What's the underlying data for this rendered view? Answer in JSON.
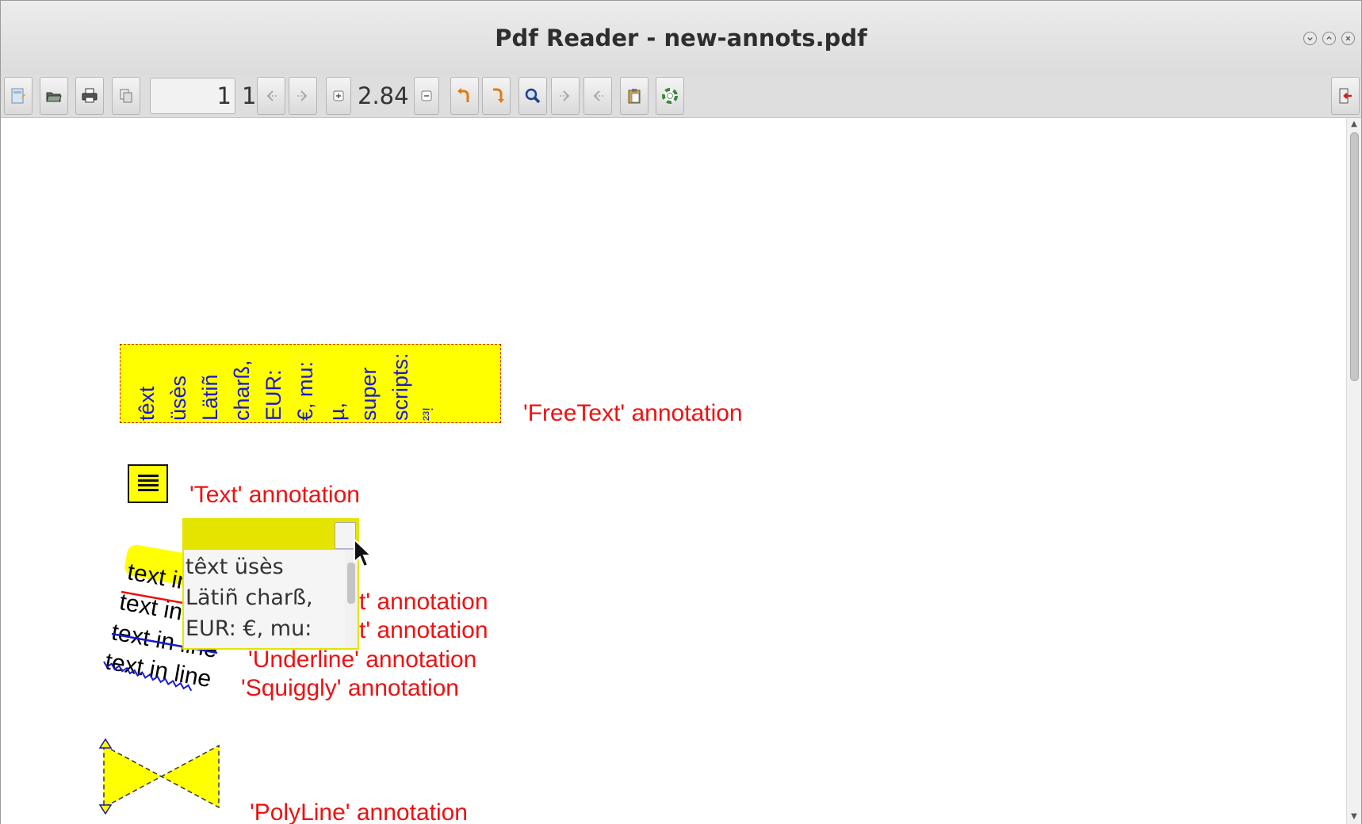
{
  "window": {
    "title": "Pdf Reader - new-annots.pdf"
  },
  "toolbar": {
    "page_value": "1",
    "page_total": "1",
    "zoom": "2.84",
    "icons": [
      "document-icon",
      "open-folder-icon",
      "print-icon",
      "copy-pages-icon",
      "prev-page-icon",
      "next-page-icon",
      "zoom-in-icon",
      "zoom-out-icon",
      "rotate-left-icon",
      "rotate-right-icon",
      "search-icon",
      "find-next-icon",
      "find-prev-icon",
      "clipboard-icon",
      "help-icon",
      "exit-icon"
    ]
  },
  "colors": {
    "annotation_yellow": "#ffff00",
    "label_red": "#ee1111",
    "text_blue": "#1a1acc",
    "popup_yellow": "#e4e400"
  },
  "freetext": {
    "words": [
      "têxt",
      "üsès",
      "Lätiñ",
      "charß,",
      "EUR:",
      "€, mu:",
      "µ,",
      "super",
      "scripts:",
      "²³!"
    ]
  },
  "labels": {
    "freetext": "'FreeText' annotation",
    "text": "'Text' annotation",
    "highlight_tail": "t' annotation",
    "strikeout_tail": "t' annotation",
    "underline": "'Underline' annotation",
    "squiggly": "'Squiggly' annotation",
    "polyline": "'PolyLine' annotation"
  },
  "markup": {
    "highlight": "text in line",
    "strikeout": "text in line",
    "underline": "text in line",
    "squiggly": "text in line"
  },
  "popup": {
    "lines": [
      "têxt üsès",
      "Lätiñ charß,",
      "EUR: €, mu:"
    ]
  }
}
